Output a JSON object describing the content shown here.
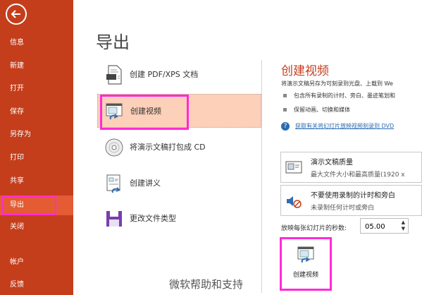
{
  "sidebar": {
    "items": [
      {
        "label": "信息"
      },
      {
        "label": "新建"
      },
      {
        "label": "打开"
      },
      {
        "label": "保存"
      },
      {
        "label": "另存为"
      },
      {
        "label": "打印"
      },
      {
        "label": "共享"
      },
      {
        "label": "导出"
      },
      {
        "label": "关闭"
      },
      {
        "label": "帐户"
      },
      {
        "label": "反馈"
      }
    ],
    "active": "导出"
  },
  "main": {
    "title": "导出",
    "options": [
      {
        "label": "创建 PDF/XPS 文档",
        "icon": "pdf-document-icon"
      },
      {
        "label": "创建视频",
        "icon": "video-icon"
      },
      {
        "label": "将演示文稿打包成 CD",
        "icon": "cd-icon"
      },
      {
        "label": "创建讲义",
        "icon": "handout-icon"
      },
      {
        "label": "更改文件类型",
        "icon": "save-disk-icon"
      }
    ]
  },
  "right": {
    "title": "创建视频",
    "description": "将演示文稿另存为可刻录到光盘、上载到 We",
    "bullets": [
      "包含所有录制的计时、旁白、墨迹笔划和",
      "保留动画、切换和媒体"
    ],
    "help_link": "获取有关将幻灯片放映视频刻录到 DVD",
    "quality": {
      "title": "演示文稿质量",
      "subtitle": "最大文件大小和最高质量(1920 x"
    },
    "narration": {
      "title": "不要使用录制的计时和旁白",
      "subtitle": "未录制任何计时或旁白"
    },
    "seconds_label": "放映每张幻灯片的秒数:",
    "seconds_value": "05.00",
    "create_button": "创建视频"
  },
  "watermark": "微软帮助和支持",
  "colors": {
    "sidebar": "#c43e1c",
    "active": "#e45b34",
    "selected": "#fcd0b9",
    "highlight": "#ff2bd6",
    "link": "#2b6cb0"
  }
}
